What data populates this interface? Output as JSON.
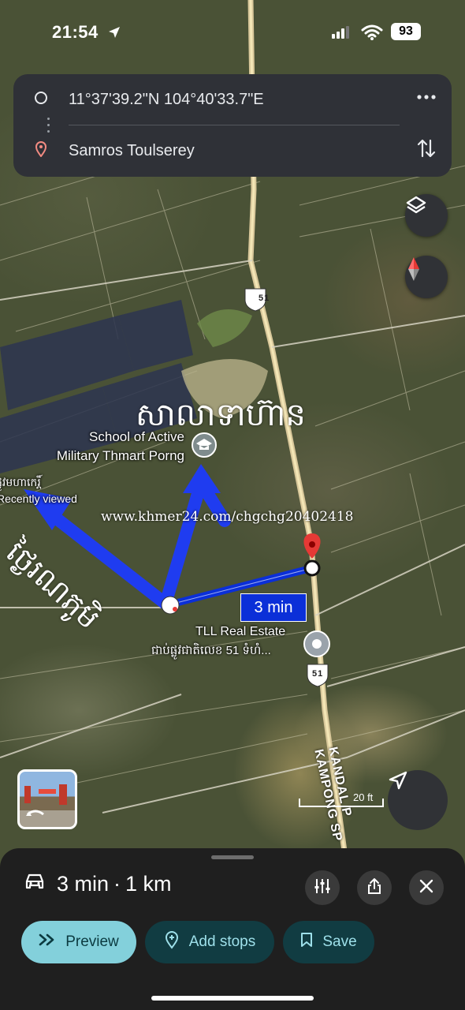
{
  "status_bar": {
    "time": "21:54",
    "battery": "93"
  },
  "directions": {
    "origin": "11°37'39.2\"N 104°40'33.7\"E",
    "destination": "Samros Toulserey"
  },
  "map": {
    "route_duration_label": "3 min",
    "highway_number": "51",
    "places": {
      "school_line1": "School of Active",
      "school_line2": "Military Thmart Porng",
      "recent_line1": "ផ្លូវមហាកេរ្តិ៍",
      "recent_line2": "Recently viewed",
      "destination_line1": "TLL Real Estate",
      "destination_line2": "ជាប់ផ្លូវជាតិលេខ 51 ទំហំ..."
    },
    "annotations": {
      "top": "សាលាទាហ៊ាន",
      "left": "ថ្ងៃរណភូមិ"
    },
    "watermark": "www.khmer24.com/chgchg20402418",
    "road_labels": [
      "KANDAL P",
      "KAMPONG SP"
    ],
    "scale_text": "20 ft"
  },
  "sheet": {
    "duration": "3 min",
    "separator": "·",
    "distance": "1 km",
    "buttons": {
      "preview": "Preview",
      "add_stops": "Add stops",
      "save": "Save"
    }
  },
  "colors": {
    "route_blue": "#0b2fd8",
    "arrow_blue": "#1f3cf0",
    "pin_red": "#e53935",
    "preview_bg": "#83d0db",
    "chip_bg": "#113c42"
  }
}
